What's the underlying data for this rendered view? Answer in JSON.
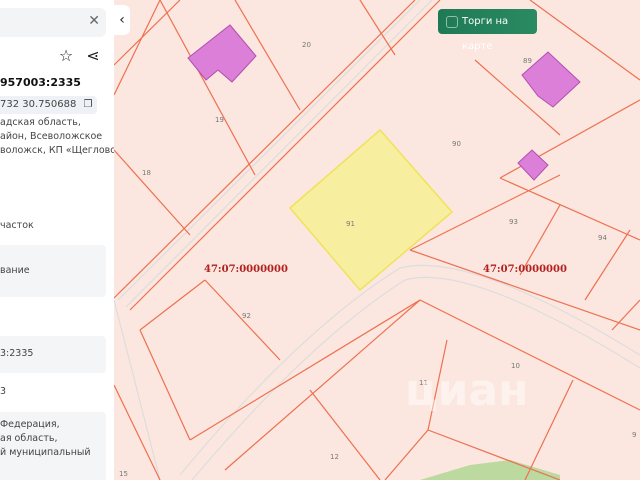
{
  "sidebar": {
    "close_icon": "close-icon",
    "star_icon": "star-icon",
    "share_icon": "share-icon",
    "title": "957003:2335",
    "coordinates": "732 30.750688",
    "address": [
      "адская область,",
      "айон, Всеволожское",
      "воложск, КП «Щеглово"
    ],
    "type_value": "часток",
    "usage_value": "вание",
    "cadastral_value": "3:2335",
    "number_value": "3",
    "region_lines": [
      "Федерация,",
      "ая область,",
      "й муниципальный"
    ]
  },
  "map": {
    "torgi_label": "Торги на карте",
    "parcel_labels": [
      "20",
      "19",
      "18",
      "90",
      "91",
      "93",
      "94",
      "92",
      "11",
      "10",
      "12",
      "15",
      "9",
      "89"
    ],
    "quarter_labels": [
      "47:07:0000000",
      "47:07:0000000"
    ],
    "watermark": "циан",
    "colors": {
      "background": "#fbe7df",
      "border": "#ee7050",
      "selected": "#f8ee9f",
      "building": "#dc7fd8",
      "green": "#bcd9a0"
    }
  }
}
